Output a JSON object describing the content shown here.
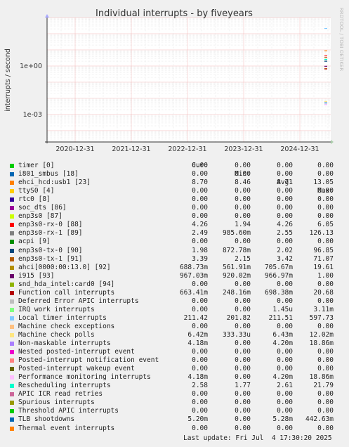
{
  "chart_data": {
    "type": "line",
    "title": "Individual interrupts - by fiveyears",
    "ylabel": "interrupts / second",
    "side_label": "RRDTOOL / TOBI OETIKER",
    "y_scale": "log",
    "ylim": [
      2e-05,
      1000
    ],
    "y_ticks": [
      {
        "value": 1,
        "label": "1e+00"
      },
      {
        "value": 0.001,
        "label": "1e-03"
      }
    ],
    "x_ticks": [
      "2020-12-31",
      "2021-12-31",
      "2022-12-31",
      "2023-12-31",
      "2024-12-31"
    ],
    "grid": true
  },
  "legend": {
    "headers": {
      "cur": "Cur:",
      "min": "Min:",
      "avg": "Avg:",
      "max": "Max:"
    },
    "items": [
      {
        "name": "timer [0]",
        "color": "#00cc00",
        "cur": "0.00",
        "min": "0.00",
        "avg": "0.00",
        "max": "0.00"
      },
      {
        "name": "i801_smbus [18]",
        "color": "#0066b3",
        "cur": "0.00",
        "min": "0.00",
        "avg": "0.00",
        "max": "0.00"
      },
      {
        "name": "ehci_hcd:usb1 [23]",
        "color": "#ff8000",
        "cur": "8.70",
        "min": "8.46",
        "avg": "8.71",
        "max": "13.05"
      },
      {
        "name": "ttyS0 [4]",
        "color": "#ffcc00",
        "cur": "0.00",
        "min": "0.00",
        "avg": "0.00",
        "max": "0.00"
      },
      {
        "name": "rtc0 [8]",
        "color": "#330099",
        "cur": "0.00",
        "min": "0.00",
        "avg": "0.00",
        "max": "0.00"
      },
      {
        "name": "soc_dts [86]",
        "color": "#990099",
        "cur": "0.00",
        "min": "0.00",
        "avg": "0.00",
        "max": "0.00"
      },
      {
        "name": "enp3s0 [87]",
        "color": "#ccff00",
        "cur": "0.00",
        "min": "0.00",
        "avg": "0.00",
        "max": "0.00"
      },
      {
        "name": "enp3s0-rx-0 [88]",
        "color": "#ff0000",
        "cur": "4.26",
        "min": "1.94",
        "avg": "4.26",
        "max": "6.05"
      },
      {
        "name": "enp3s0-rx-1 [89]",
        "color": "#808080",
        "cur": "2.49",
        "min": "985.60m",
        "avg": "2.55",
        "max": "126.13"
      },
      {
        "name": "acpi [9]",
        "color": "#008f00",
        "cur": "0.00",
        "min": "0.00",
        "avg": "0.00",
        "max": "0.00"
      },
      {
        "name": "enp3s0-tx-0 [90]",
        "color": "#00487d",
        "cur": "1.98",
        "min": "872.78m",
        "avg": "2.02",
        "max": "96.85"
      },
      {
        "name": "enp3s0-tx-1 [91]",
        "color": "#b35a00",
        "cur": "3.39",
        "min": "2.15",
        "avg": "3.42",
        "max": "71.07"
      },
      {
        "name": "ahci[0000:00:13.0] [92]",
        "color": "#b38f00",
        "cur": "688.73m",
        "min": "561.91m",
        "avg": "705.67m",
        "max": "19.61"
      },
      {
        "name": "i915 [93]",
        "color": "#6b006b",
        "cur": "967.03m",
        "min": "920.02m",
        "avg": "966.97m",
        "max": "1.00"
      },
      {
        "name": "snd_hda_intel:card0 [94]",
        "color": "#8fb300",
        "cur": "0.00",
        "min": "0.00",
        "avg": "0.00",
        "max": "0.00"
      },
      {
        "name": "Function call interrupts",
        "color": "#b30000",
        "cur": "663.41m",
        "min": "248.16m",
        "avg": "698.38m",
        "max": "20.68"
      },
      {
        "name": "Deferred Error APIC interrupts",
        "color": "#bebebe",
        "cur": "0.00",
        "min": "0.00",
        "avg": "0.00",
        "max": "0.00"
      },
      {
        "name": "IRQ work interrupts",
        "color": "#80ff80",
        "cur": "0.00",
        "min": "0.00",
        "avg": "1.45u",
        "max": "3.11m"
      },
      {
        "name": "Local timer interrupts",
        "color": "#80c9ff",
        "cur": "211.42",
        "min": "201.82",
        "avg": "211.51",
        "max": "597.73"
      },
      {
        "name": "Machine check exceptions",
        "color": "#ffc080",
        "cur": "0.00",
        "min": "0.00",
        "avg": "0.00",
        "max": "0.00"
      },
      {
        "name": "Machine check polls",
        "color": "#ffe680",
        "cur": "6.42m",
        "min": "333.33u",
        "avg": "6.43m",
        "max": "12.02m"
      },
      {
        "name": "Non-maskable interrupts",
        "color": "#aa80ff",
        "cur": "4.18m",
        "min": "0.00",
        "avg": "4.20m",
        "max": "18.86m"
      },
      {
        "name": "Nested posted-interrupt event",
        "color": "#ee00cc",
        "cur": "0.00",
        "min": "0.00",
        "avg": "0.00",
        "max": "0.00"
      },
      {
        "name": "Posted-interrupt notification event",
        "color": "#ff8080",
        "cur": "0.00",
        "min": "0.00",
        "avg": "0.00",
        "max": "0.00"
      },
      {
        "name": "Posted-interrupt wakeup event",
        "color": "#666600",
        "cur": "0.00",
        "min": "0.00",
        "avg": "0.00",
        "max": "0.00"
      },
      {
        "name": "Performance monitoring interrupts",
        "color": "#ffbfff",
        "cur": "4.18m",
        "min": "0.00",
        "avg": "4.20m",
        "max": "18.86m"
      },
      {
        "name": "Rescheduling interrupts",
        "color": "#00ffcc",
        "cur": "2.58",
        "min": "1.77",
        "avg": "2.61",
        "max": "21.79"
      },
      {
        "name": "APIC ICR read retries",
        "color": "#cc6699",
        "cur": "0.00",
        "min": "0.00",
        "avg": "0.00",
        "max": "0.00"
      },
      {
        "name": "Spurious interrupts",
        "color": "#999900",
        "cur": "0.00",
        "min": "0.00",
        "avg": "0.00",
        "max": "0.00"
      },
      {
        "name": "Threshold APIC interrupts",
        "color": "#00cc00",
        "cur": "0.00",
        "min": "0.00",
        "avg": "0.00",
        "max": "0.00"
      },
      {
        "name": "TLB shootdowns",
        "color": "#0066b3",
        "cur": "5.20m",
        "min": "0.00",
        "avg": "5.28m",
        "max": "442.63m"
      },
      {
        "name": "Thermal event interrupts",
        "color": "#ff8000",
        "cur": "0.00",
        "min": "0.00",
        "avg": "0.00",
        "max": "0.00"
      }
    ]
  },
  "footer": "Last update: Fri Jul  4 17:30:20 2025"
}
